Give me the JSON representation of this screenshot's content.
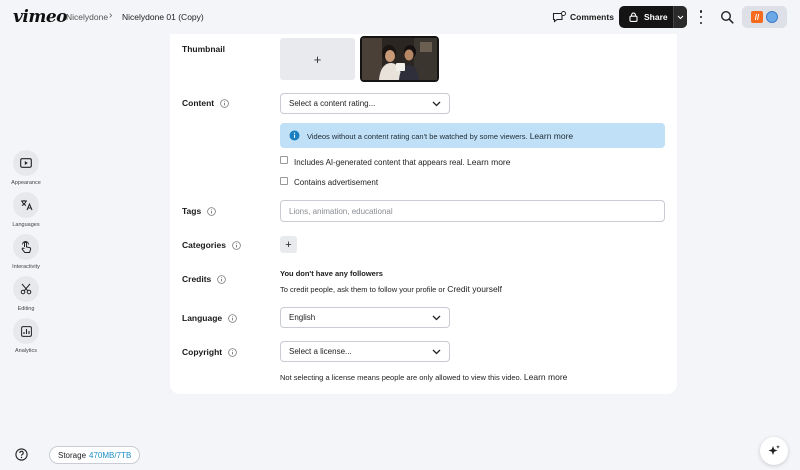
{
  "header": {
    "logo": "vimeo",
    "breadcrumb_folder": "Nicelydone",
    "breadcrumb_video": "Nicelydone 01 (Copy)",
    "comments_label": "Comments",
    "share_label": "Share"
  },
  "rail": {
    "items": [
      {
        "label": "Appearance",
        "icon": "play-icon"
      },
      {
        "label": "Languages",
        "icon": "translate-icon"
      },
      {
        "label": "Interactivity",
        "icon": "pointer-icon"
      },
      {
        "label": "Editing",
        "icon": "scissors-icon"
      },
      {
        "label": "Analytics",
        "icon": "chart-icon"
      }
    ]
  },
  "footer": {
    "storage_label": "Storage",
    "storage_value": "470MB/7TB"
  },
  "form": {
    "thumbnail_label": "Thumbnail",
    "thumbnail_add": "+",
    "content_label": "Content",
    "content_select": "Select a content rating...",
    "notice_text": "Videos without a content rating can't be watched by some viewers.",
    "learn_more": "Learn more",
    "ai_check_label": "Includes AI-generated content that appears real.",
    "ad_check_label": "Contains advertisement",
    "tags_label": "Tags",
    "tags_placeholder": "Lions, animation, educational",
    "categories_label": "Categories",
    "categories_add": "+",
    "credits_label": "Credits",
    "credits_title": "You don't have any followers",
    "credits_text": "To credit people, ask them to follow your profile or",
    "credit_yourself": "Credit yourself",
    "language_label": "Language",
    "language_value": "English",
    "copyright_label": "Copyright",
    "copyright_select": "Select a license...",
    "license_note": "Not selecting a license means people are only allowed to view this video."
  },
  "colors": {
    "accent": "#1a8ec9",
    "notice_bg": "#bfe0f6",
    "share_bg": "#141414"
  }
}
